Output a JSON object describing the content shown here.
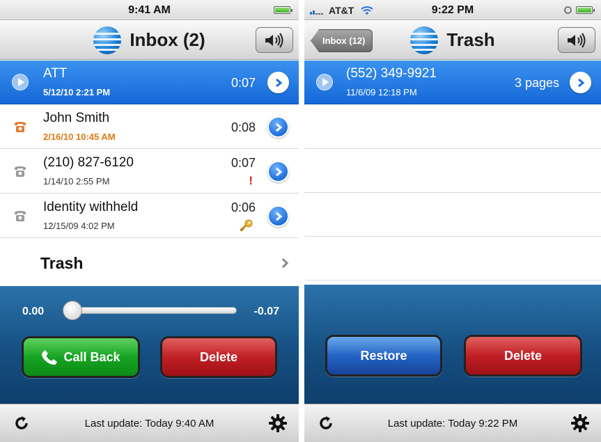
{
  "left": {
    "status": {
      "time": "9:41 AM"
    },
    "nav": {
      "title": "Inbox (2)"
    },
    "messages": [
      {
        "name": "ATT",
        "date": "5/12/10 2:21 PM",
        "duration": "0:07",
        "selected": true
      },
      {
        "name": "John Smith",
        "date": "2/16/10 10:45 AM",
        "duration": "0:08",
        "date_color": "#e07a12"
      },
      {
        "name": "(210) 827-6120",
        "date": "1/14/10 2:55 PM",
        "duration": "0:07",
        "badge": "!"
      },
      {
        "name": "Identity withheld",
        "date": "12/15/09 4:02 PM",
        "duration": "0:06",
        "badge": "key"
      }
    ],
    "trash": {
      "label": "Trash"
    },
    "player": {
      "elapsed": "0.00",
      "remaining": "-0.07",
      "progress": 0.0
    },
    "buttons": {
      "call_back": "Call Back",
      "delete": "Delete"
    },
    "toolbar": {
      "update": "Last update: Today 9:40 AM"
    }
  },
  "right": {
    "status": {
      "carrier": "AT&T",
      "time": "9:22 PM"
    },
    "nav": {
      "back": "Inbox (12)",
      "title": "Trash"
    },
    "messages": [
      {
        "name": "(552) 349-9921",
        "date": "11/6/09 12:18 PM",
        "pages": "3 pages",
        "selected": true
      }
    ],
    "buttons": {
      "restore": "Restore",
      "delete": "Delete"
    },
    "toolbar": {
      "update": "Last update: Today 9:22 PM"
    }
  },
  "colors": {
    "selected_row": "#1e74de",
    "accent_orange": "#e07a12",
    "call_green": "#17a323",
    "delete_red": "#c11f24",
    "restore_blue": "#2463c4",
    "player_bg": "#164f82"
  },
  "icons": [
    "play-icon",
    "phone-icon",
    "chevron-right-icon",
    "speaker-icon",
    "att-globe-icon",
    "alert-icon",
    "key-icon",
    "refresh-icon",
    "gear-icon",
    "wifi-icon",
    "battery-icon"
  ]
}
